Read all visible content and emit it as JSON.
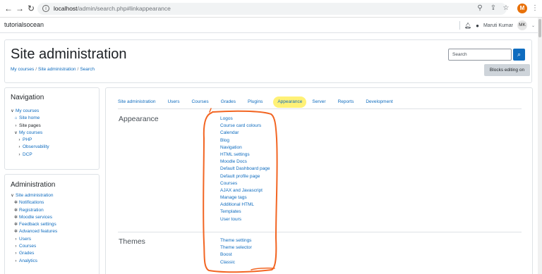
{
  "browser": {
    "url_host": "localhost",
    "url_rest": "/admin/search.php#linkappearance",
    "profile_initial": "M"
  },
  "navbar": {
    "brand": "tutorialsocean",
    "user_name": "Maruti Kumar",
    "avatar_initials": "MK"
  },
  "header": {
    "title": "Site administration",
    "breadcrumb": [
      "My courses",
      "Site administration",
      "Search"
    ],
    "search_placeholder": "Search",
    "blocks_button": "Blocks editing on"
  },
  "navigation_block": {
    "title": "Navigation",
    "items": [
      {
        "label": "My courses",
        "icon": "chevron-down-icon",
        "style": "link",
        "indent": 0
      },
      {
        "label": "Site home",
        "icon": "home-icon",
        "style": "link",
        "indent": 1
      },
      {
        "label": "Site pages",
        "icon": "chevron-right-icon",
        "style": "dark",
        "indent": 1
      },
      {
        "label": "My courses",
        "icon": "chevron-down-icon",
        "style": "link",
        "indent": 1
      },
      {
        "label": "PHP",
        "icon": "chevron-right-icon",
        "style": "link",
        "indent": 2
      },
      {
        "label": "Observability",
        "icon": "chevron-right-icon",
        "style": "link",
        "indent": 2
      },
      {
        "label": "DCP",
        "icon": "chevron-right-icon",
        "style": "link",
        "indent": 2
      }
    ]
  },
  "admin_block": {
    "title": "Administration",
    "items": [
      {
        "label": "Site administration",
        "icon": "chevron-down-icon",
        "indent": 0
      },
      {
        "label": "Notifications",
        "icon": "gear-icon",
        "indent": 1
      },
      {
        "label": "Registration",
        "icon": "gear-icon",
        "indent": 1
      },
      {
        "label": "Moodle services",
        "icon": "gear-icon",
        "indent": 1
      },
      {
        "label": "Feedback settings",
        "icon": "gear-icon",
        "indent": 1
      },
      {
        "label": "Advanced features",
        "icon": "gear-icon",
        "indent": 1
      },
      {
        "label": "Users",
        "icon": "chevron-right-icon",
        "indent": 1
      },
      {
        "label": "Courses",
        "icon": "chevron-right-icon",
        "indent": 1
      },
      {
        "label": "Grades",
        "icon": "chevron-right-icon",
        "indent": 1
      },
      {
        "label": "Analytics",
        "icon": "chevron-right-icon",
        "indent": 1
      }
    ]
  },
  "tabs": [
    "Site administration",
    "Users",
    "Courses",
    "Grades",
    "Plugins",
    "Appearance",
    "Server",
    "Reports",
    "Development"
  ],
  "active_tab": "Appearance",
  "sections": [
    {
      "title": "Appearance",
      "links": [
        "Logos",
        "Course card colours",
        "Calendar",
        "Blog",
        "Navigation",
        "HTML settings",
        "Moodle Docs",
        "Default Dashboard page",
        "Default profile page",
        "Courses",
        "AJAX and Javascript",
        "Manage tags",
        "Additional HTML",
        "Templates",
        "User tours"
      ]
    },
    {
      "title": "Themes",
      "links": [
        "Theme settings",
        "Theme selector",
        "Boost",
        "Classic"
      ]
    }
  ],
  "colors": {
    "link": "#0f6cbf",
    "highlight": "#fff176",
    "annotation": "#f26522",
    "profile": "#e8710a"
  }
}
